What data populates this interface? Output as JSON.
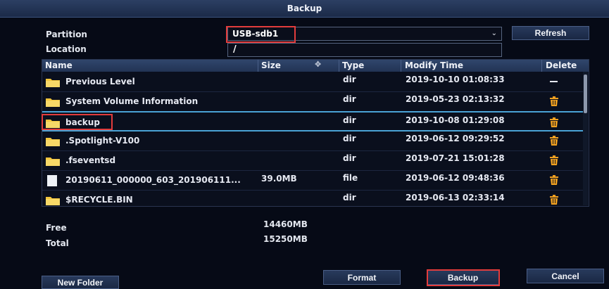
{
  "window": {
    "title": "Backup"
  },
  "form": {
    "partition_label": "Partition",
    "partition_value": "USB-sdb1",
    "location_label": "Location",
    "location_value": "/",
    "refresh_label": "Refresh"
  },
  "table": {
    "columns": {
      "name": "Name",
      "size": "Size",
      "type": "Type",
      "modify": "Modify Time",
      "delete": "Delete"
    },
    "rows": [
      {
        "name": "Previous Level",
        "size": "",
        "type": "dir",
        "time": "2019-10-10 01:08:33",
        "icon": "folder-icon",
        "action": "dash-icon"
      },
      {
        "name": "System Volume Information",
        "size": "",
        "type": "dir",
        "time": "2019-05-23 02:13:32",
        "icon": "folder-icon",
        "action": "trash-icon"
      },
      {
        "name": "backup",
        "size": "",
        "type": "dir",
        "time": "2019-10-08 01:29:08",
        "icon": "folder-icon",
        "action": "trash-icon"
      },
      {
        "name": ".Spotlight-V100",
        "size": "",
        "type": "dir",
        "time": "2019-06-12 09:29:52",
        "icon": "folder-icon",
        "action": "trash-icon"
      },
      {
        "name": ".fseventsd",
        "size": "",
        "type": "dir",
        "time": "2019-07-21 15:01:28",
        "icon": "folder-icon",
        "action": "trash-icon"
      },
      {
        "name": "20190611_000000_603_201906111...",
        "size": "39.0MB",
        "type": "file",
        "time": "2019-06-12 09:48:36",
        "icon": "file-icon",
        "action": "trash-icon"
      },
      {
        "name": "$RECYCLE.BIN",
        "size": "",
        "type": "dir",
        "time": "2019-06-13 02:33:14",
        "icon": "folder-icon",
        "action": "trash-icon"
      }
    ]
  },
  "stats": {
    "free_label": "Free",
    "free_value": "14460MB",
    "total_label": "Total",
    "total_value": "15250MB"
  },
  "buttons": {
    "new_folder": "New Folder",
    "format": "Format",
    "backup": "Backup",
    "cancel": "Cancel"
  },
  "colors": {
    "highlight": "#e23c3c",
    "selection": "#4aa3d6",
    "trash": "#f0a020",
    "folder": "#f2c53d"
  }
}
